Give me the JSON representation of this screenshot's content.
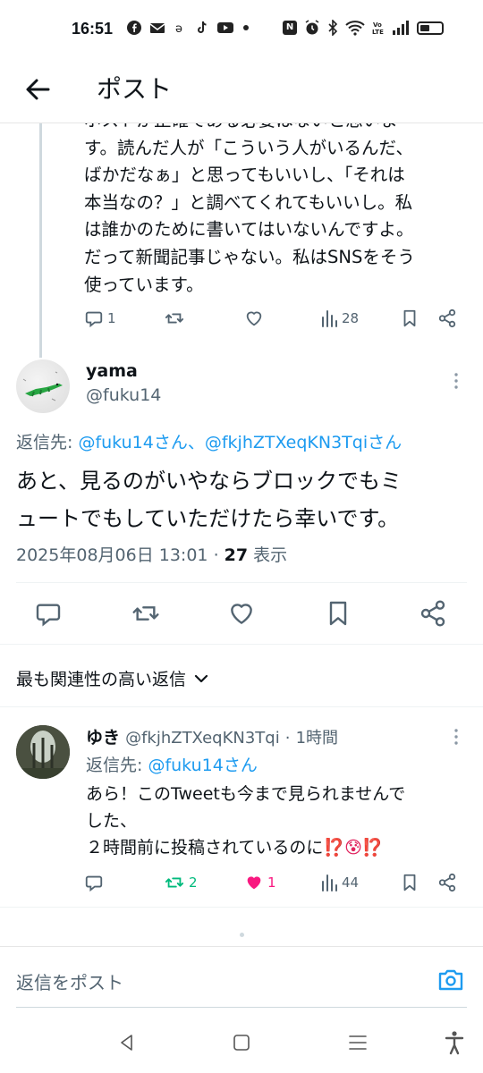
{
  "status_bar": {
    "time": "16:51",
    "left_icons": [
      "facebook-icon",
      "mail-icon",
      "app-icon",
      "tiktok-icon",
      "youtube-icon",
      "dot-icon"
    ],
    "right_icons": [
      "nfc-icon",
      "alarm-icon",
      "bluetooth-icon",
      "wifi-icon",
      "volte-icon",
      "signal-icon",
      "battery-icon"
    ],
    "volte_label": "Vo LTE"
  },
  "header": {
    "title": "ポスト",
    "back_icon": "arrow-left-icon"
  },
  "previous_post": {
    "body": "ポストが正確である必要はないと思いま\nす。読んだ人が「こういう人がいるんだ、\nばかだなぁ」と思ってもいいし、「それは\n本当なの？」と調べてくれてもいいし。私\nは誰かのために書いてはいないんですよ。\nだって新聞記事じゃない。私はSNSをそう\n使っています。",
    "reply_count": "1",
    "view_count": "28"
  },
  "main_post": {
    "display_name": "yama",
    "handle": "@fuku14",
    "reply_to_label": "返信先: ",
    "reply_to_mention_1": "@fuku14さん",
    "reply_to_separator": "、",
    "reply_to_mention_2": "@fkjhZTXeqKN3Tqiさん",
    "body_line_1": "あと、見るのがいやならブロックでもミ",
    "body_line_2": "ュートでもしていただけたら幸いです。",
    "timestamp": "2025年08月06日 13:01",
    "dot": "·",
    "views_count": "27",
    "views_label": "表示"
  },
  "replies_section": {
    "sort_label": "最も関連性の高い返信"
  },
  "reply": {
    "display_name": "ゆき",
    "handle": "@fkjhZTXeqKN3Tqi",
    "dot": "·",
    "time_ago": "1時間",
    "reply_to_label": "返信先: ",
    "reply_to_mention": "@fuku14さん",
    "body_line_1": "あら！このTweetも今まで見られませんで",
    "body_line_2": "した、",
    "body_line_3": "２時間前に投稿されているのに",
    "emoji": "⁉️😰⁉️",
    "retweet_count": "2",
    "like_count": "1",
    "view_count": "44",
    "colors": {
      "retweet": "#00ba7c",
      "like": "#f91880"
    }
  },
  "composer": {
    "placeholder": "返信をポスト",
    "camera_icon": "camera-icon"
  },
  "nav_bar": {
    "icons": [
      "back-triangle-icon",
      "home-square-icon",
      "recents-icon",
      "accessibility-icon"
    ]
  },
  "colors": {
    "accent": "#1d9bf0",
    "text": "#0f1419",
    "muted": "#536471"
  }
}
